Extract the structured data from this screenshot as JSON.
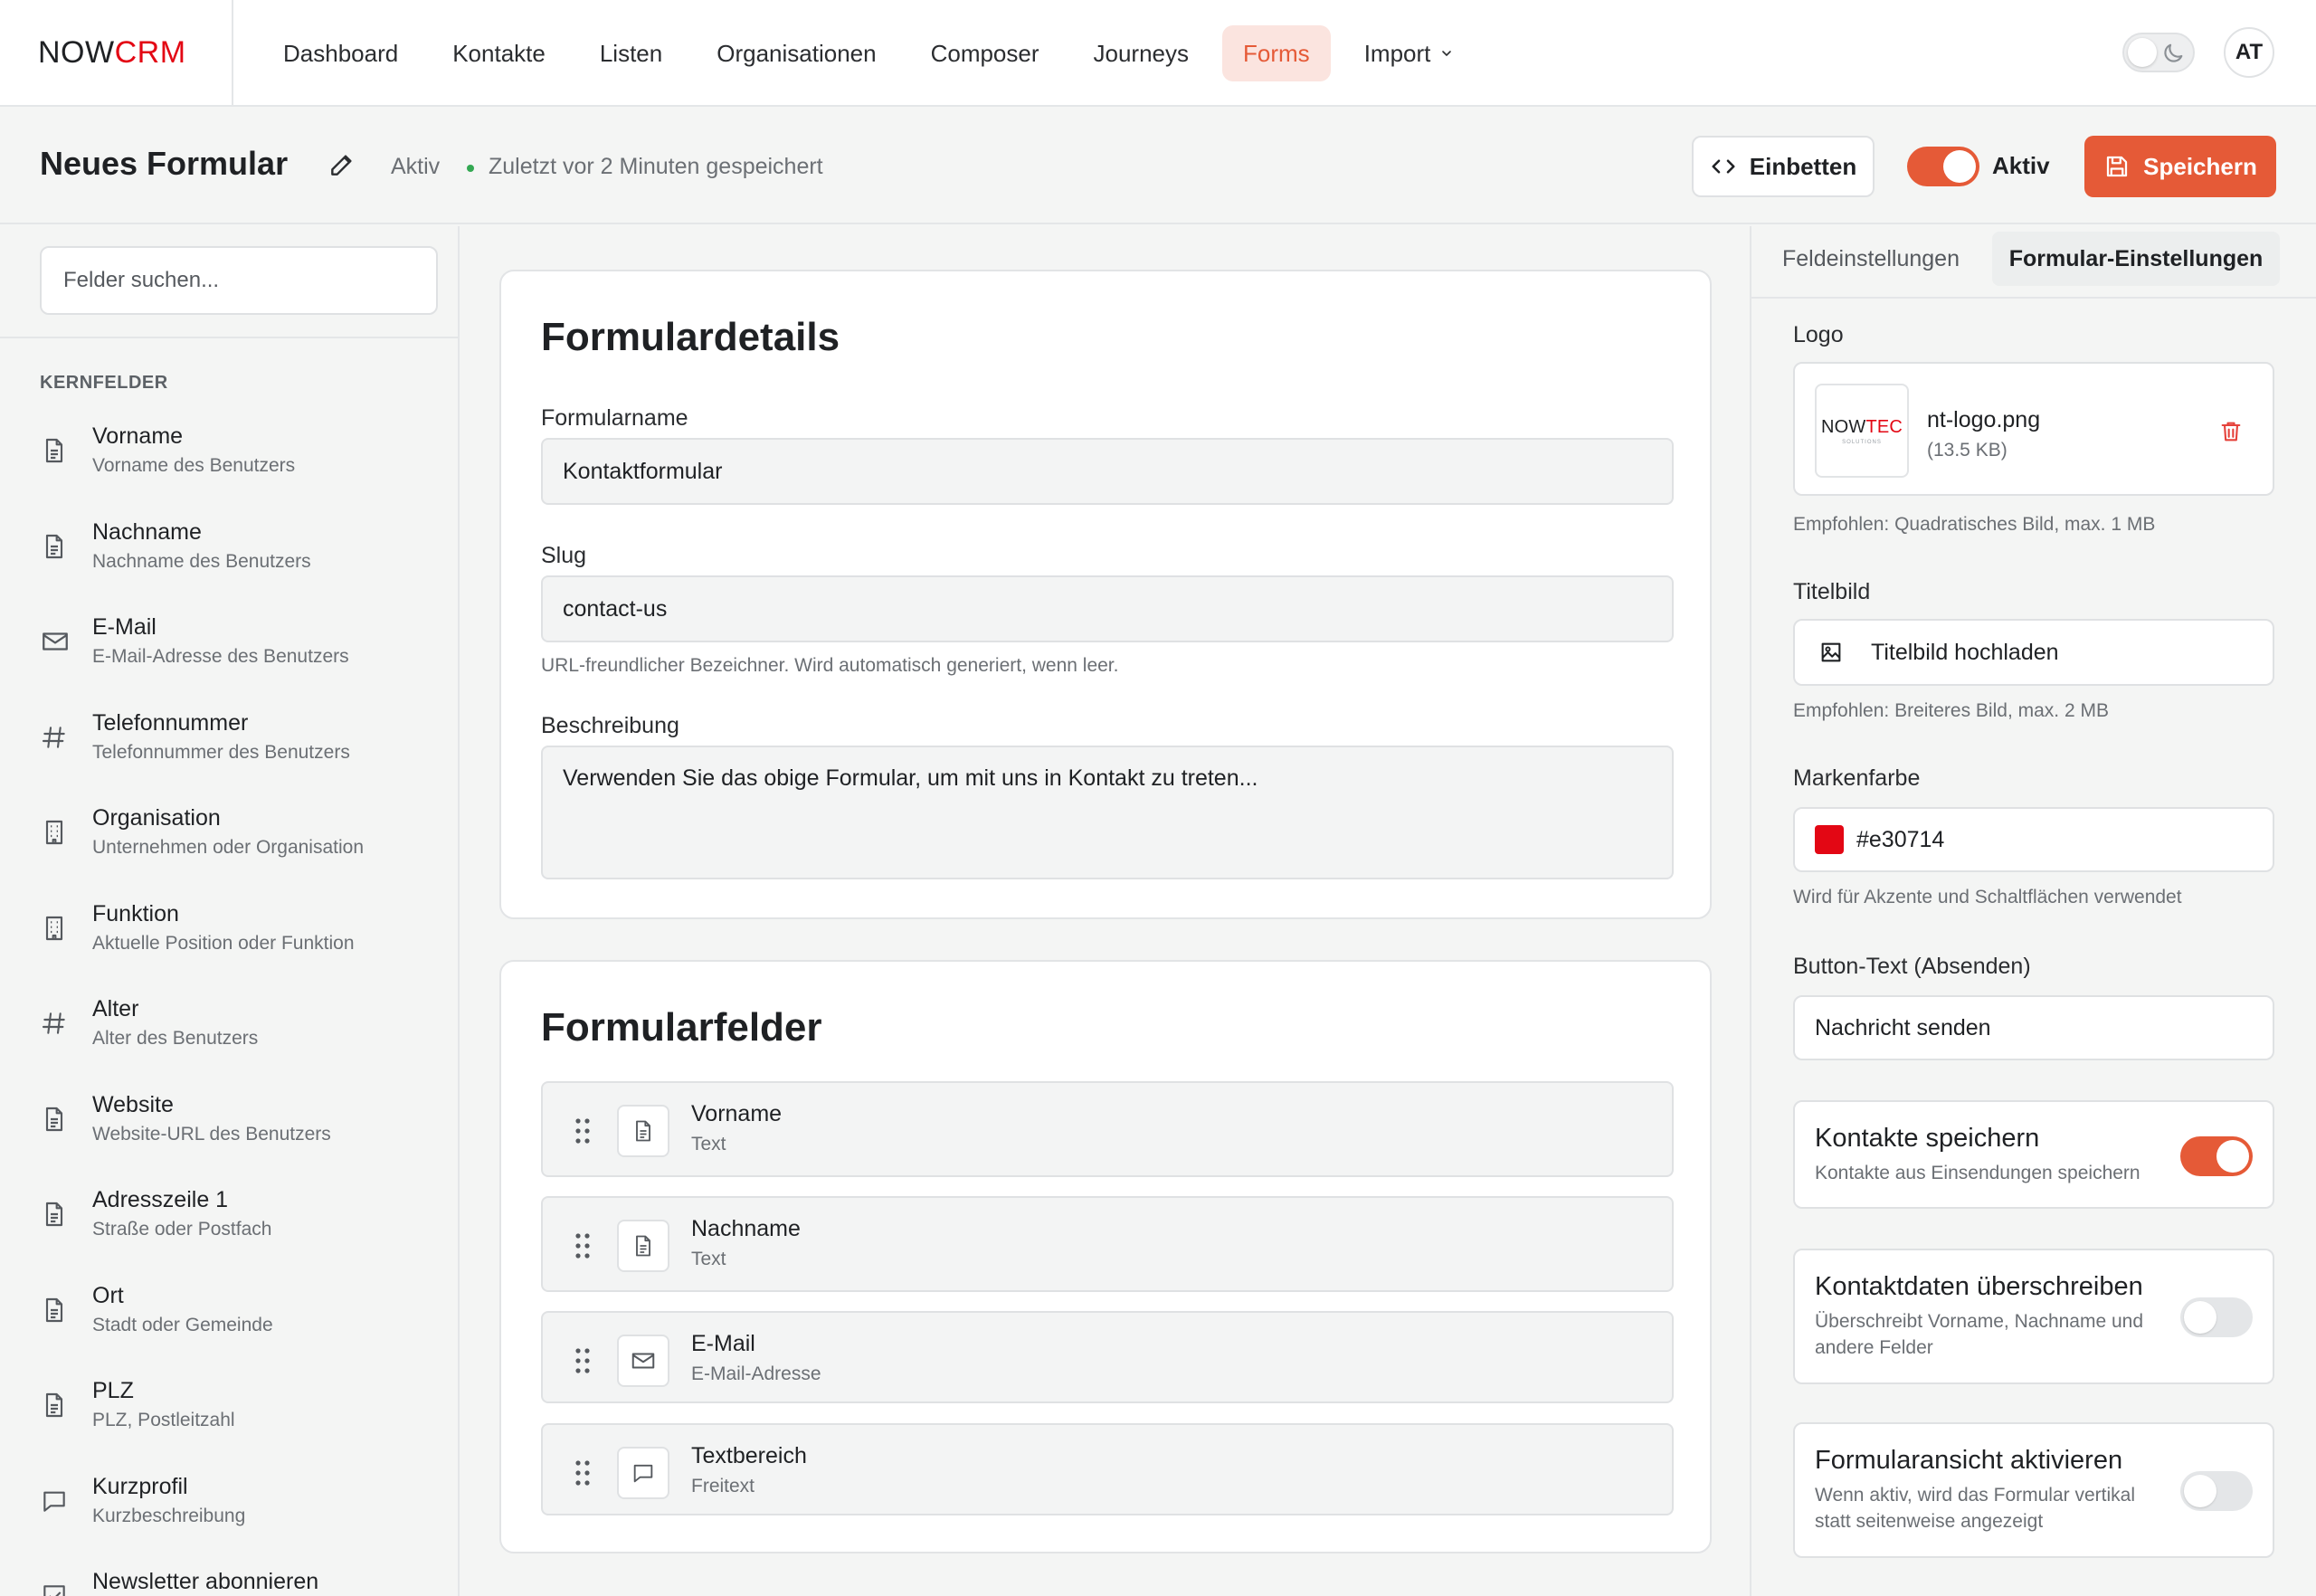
{
  "app": {
    "logo_now": "NOW",
    "logo_crm": "CRM"
  },
  "nav": {
    "items": [
      "Dashboard",
      "Kontakte",
      "Listen",
      "Organisationen",
      "Composer",
      "Journeys",
      "Forms",
      "Import"
    ],
    "active": "Forms",
    "avatar": "AT"
  },
  "header": {
    "title": "Neues Formular",
    "status": "Aktiv",
    "saved": "Zuletzt vor 2 Minuten gespeichert",
    "embed_label": "Einbetten",
    "active_label": "Aktiv",
    "save_label": "Speichern"
  },
  "sidebar": {
    "search_placeholder": "Felder suchen...",
    "section": "KERNFELDER",
    "fields": [
      {
        "name": "Vorname",
        "desc": "Vorname des Benutzers",
        "icon": "document-icon"
      },
      {
        "name": "Nachname",
        "desc": "Nachname des Benutzers",
        "icon": "document-icon"
      },
      {
        "name": "E-Mail",
        "desc": "E-Mail-Adresse des Benutzers",
        "icon": "mail-icon"
      },
      {
        "name": "Telefonnummer",
        "desc": "Telefonnummer des Benutzers",
        "icon": "hash-icon"
      },
      {
        "name": "Organisation",
        "desc": "Unternehmen oder Organisation",
        "icon": "building-icon"
      },
      {
        "name": "Funktion",
        "desc": "Aktuelle Position oder Funktion",
        "icon": "building-icon"
      },
      {
        "name": "Alter",
        "desc": "Alter des Benutzers",
        "icon": "hash-icon"
      },
      {
        "name": "Website",
        "desc": "Website-URL des Benutzers",
        "icon": "document-icon"
      },
      {
        "name": "Adresszeile 1",
        "desc": "Straße oder Postfach",
        "icon": "document-icon"
      },
      {
        "name": "Ort",
        "desc": "Stadt oder Gemeinde",
        "icon": "document-icon"
      },
      {
        "name": "PLZ",
        "desc": "PLZ, Postleitzahl",
        "icon": "document-icon"
      },
      {
        "name": "Kurzprofil",
        "desc": "Kurzbeschreibung",
        "icon": "chat-icon"
      },
      {
        "name": "Newsletter abonnieren",
        "desc": "",
        "icon": "checkbox-icon"
      }
    ]
  },
  "details": {
    "title": "Formulardetails",
    "name_label": "Formularname",
    "name_value": "Kontaktformular",
    "slug_label": "Slug",
    "slug_value": "contact-us",
    "slug_hint": "URL-freundlicher Bezeichner. Wird automatisch generiert, wenn leer.",
    "desc_label": "Beschreibung",
    "desc_value": "Verwenden Sie das obige Formular, um mit uns in Kontakt zu treten..."
  },
  "formfields": {
    "title": "Formularfelder",
    "rows": [
      {
        "name": "Vorname",
        "type": "Text",
        "icon": "document-icon"
      },
      {
        "name": "Nachname",
        "type": "Text",
        "icon": "document-icon"
      },
      {
        "name": "E-Mail",
        "type": "E-Mail-Adresse",
        "icon": "mail-icon"
      },
      {
        "name": "Textbereich",
        "type": "Freitext",
        "icon": "chat-icon"
      }
    ]
  },
  "settings": {
    "tab_field": "Feldeinstellungen",
    "tab_form": "Formular-Einstellungen",
    "logo_label": "Logo",
    "logo_brand_a": "NOW",
    "logo_brand_b": "TEC",
    "logo_brand_sub": "SOLUTIONS",
    "logo_file": "nt-logo.png",
    "logo_size": "(13.5 KB)",
    "logo_hint": "Empfohlen: Quadratisches Bild, max. 1 MB",
    "cover_label": "Titelbild",
    "cover_upload": "Titelbild hochladen",
    "cover_hint": "Empfohlen: Breiteres Bild, max. 2 MB",
    "brand_label": "Markenfarbe",
    "brand_color": "#e30714",
    "brand_hint": "Wird für Akzente und Schaltflächen verwendet",
    "button_label": "Button-Text (Absenden)",
    "button_value": "Nachricht senden",
    "toggles": [
      {
        "title": "Kontakte speichern",
        "desc": "Kontakte aus Einsendungen speichern",
        "on": true
      },
      {
        "title": "Kontaktdaten überschreiben",
        "desc": "Überschreibt Vorname, Nachname und andere Felder",
        "on": false
      },
      {
        "title": "Formularansicht aktivieren",
        "desc": "Wenn aktiv, wird das Formular vertikal statt seitenweise angezeigt",
        "on": false
      }
    ]
  },
  "colors": {
    "accent": "#e55a37",
    "brand_red": "#e30714"
  }
}
